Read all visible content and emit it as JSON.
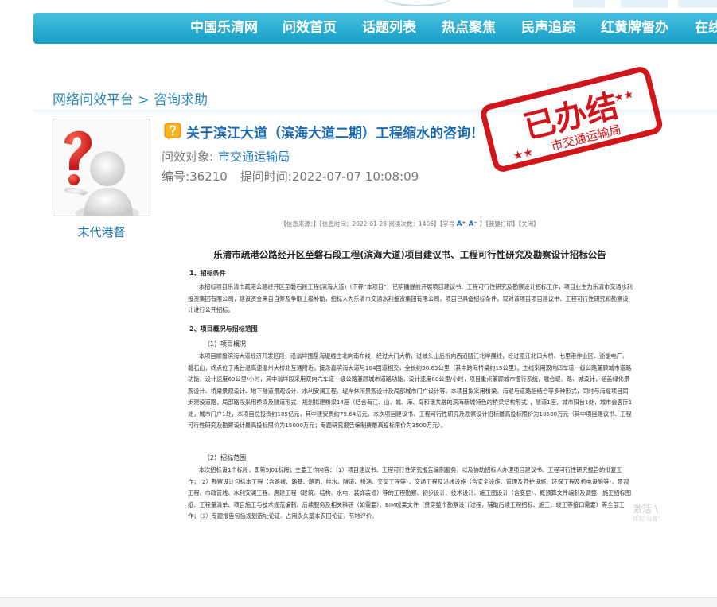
{
  "nav": {
    "items": [
      "中国乐清网",
      "问效首页",
      "话题列表",
      "热点聚焦",
      "民声追踪",
      "红黄牌督办",
      "在线"
    ]
  },
  "breadcrumb": {
    "platform": "网络问效平台",
    "separator": ">",
    "current": "咨询求助"
  },
  "question": {
    "asker": "末代港督",
    "title": "关于滨江大道（滨海大道二期）工程缩水的咨询！",
    "target_label": "问效对象:",
    "target_value": "市交通运输局",
    "number_label": "编号:",
    "number_value": "36210",
    "time_label": "提问时间:",
    "time_value": "2022-07-07 10:08:09"
  },
  "stamp": {
    "main": "已办结",
    "sub": "市交通运输局"
  },
  "document": {
    "meta": [
      "【信息来源：】【信息时间：2022-01-28 阅读次数：1406】【字号",
      "】【我要打印】【关闭】"
    ],
    "font_size_glyphs": "A⁺ A⁻",
    "heading": "乐清市疏港公路经开区至磐石段工程(滨海大道)项目建议书、工程可行性研究及勘察设计招标公告",
    "sections": [
      {
        "label": "1、招标条件",
        "paragraphs": [
          "本招标项目乐清市疏港公路经开区至磐石段工程(滨海大道)（下称“本项目”）已明确提前开展项目建议书、工程可行性研究及勘察设计招标工作，项目业主为乐清市交通水利投资集团有限公司，建设资金来自自筹及争取上级补助，招标人为乐清市交通水利投资集团有限公司，项目已具备招标条件，现对该项目项目建议书、工程可行性研究和勘察设计进行公开招标。"
        ]
      },
      {
        "label": "2、项目概况与招标范围",
        "sub": "（1）项目概况",
        "paragraphs": [
          "本项目顺接滨海大道经济开发区段，沿翁垟围垦海堤线由北向南布线，经过大门大桥，过岐头山后折向西沿瓯江北岸展线，经过瓯江北口大桥、七里港作业区、浙能电厂、磐石山，终点位于甬台温高速温州大桥北互通附近，接永嘉滨海大道与104国道相交，全长约30.63公里（其中跨海桥梁约15公里）。主线采用双向四车道一级公路兼顾城市道路功能，设计速度60公里/小时，其中翁垟段采用双向六车道一级公路兼顾城市道路功能，设计速度80公里/小时，项目重点兼顾城市慢行系统，融合堤、路、城设计，涵盖绿化景观设计、桥梁景观设计、地下隧道景观设计、水利安澜工程、堤岸休闲景观设计及局部城市门户设计等。本项目拟采用桥梁、海堤与道路相结合等多种形式，同时与海堤项目同步建设道路，局部路段采用桥梁及隧道形式，规划拟建桥梁14座（结合有江、山、城、海、岛和谐共融的滨海新城特色的桥梁结构形式），隧道1座，城市阳台1处，城市会客厅1处，城市门户1处，本项目总投资约105亿元，其中建安费约79.64亿元。本次项目建议书、工程可行性研究及勘察设计招标最高投标限价为18500万元（其中项目建议书、工程可行性研究及勘察设计最高投标限价为15000万元；专题研究报告编制费最高投标限价为3500万元）。"
        ]
      },
      {
        "sub": "（2）招标范围",
        "paragraphs": [
          "本次招标设1个标段，即第SJ01标段；主要工作内容：（1）项目建议书、工程可行性研究报告编制服务，以及协助招标人办理项目建议书、工程可行性研究报告的批复工作；（2）勘察设计包括本工程（含路线、路基、路面、排水、隧道、桥涵、交叉工程等）、交通工程及沿线设施（含安全设施、管理及养护设施、环保工程及机电设施等）、景观工程、市政管线、水利安澜工程、房建工程（建筑、结构、水电、装饰装修）等的工程勘察、初步设计、技术设计、施工图设计（含变更）、概预算文件编制及调整、施工招标图纸、工程量清单、项目施工与技术规范编制、后续服务及相关科研（如需要）、BIM成果文件（贯穿整个勘察设计过程，辅助后续工程招标、施工、竣工等接口需要）等全部工作；（3）专题报告包括规划选址论证、占用永久基本农田论证、节地评价。"
        ]
      }
    ]
  },
  "watermark": {
    "line1": "激活 \\",
    "line2": "转到\"设置\""
  },
  "colors": {
    "nav_top": "#45c0df",
    "nav_bottom": "#169fc6",
    "link_blue": "#1d6ab0",
    "stamp_red": "#d2141b"
  }
}
